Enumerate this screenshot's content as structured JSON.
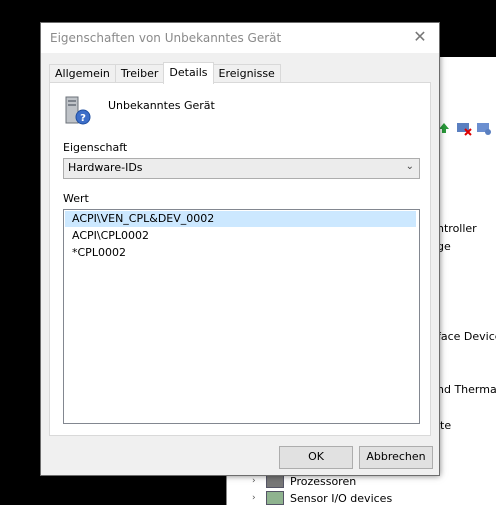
{
  "background": {
    "partial_texts": [
      "ntroller",
      "ge",
      "face Device",
      "nd Thermal",
      "ite"
    ],
    "tree_items": [
      {
        "label": "Prozessoren",
        "icon": "processor-icon"
      },
      {
        "label": "Sensor I/O devices",
        "icon": "sensor-icon"
      }
    ],
    "toolbar_icons": [
      "update-driver-icon",
      "disable-device-icon",
      "uninstall-device-icon",
      "scan-hardware-icon"
    ]
  },
  "dialog": {
    "title": "Eigenschaften von Unbekanntes Gerät",
    "close_symbol": "✕",
    "tabs": [
      {
        "label": "Allgemein",
        "active": false
      },
      {
        "label": "Treiber",
        "active": false
      },
      {
        "label": "Details",
        "active": true
      },
      {
        "label": "Ereignisse",
        "active": false
      }
    ],
    "device_name": "Unbekanntes Gerät",
    "property_label": "Eigenschaft",
    "property_selected": "Hardware-IDs",
    "value_label": "Wert",
    "values": [
      "ACPI\\VEN_CPL&DEV_0002",
      "ACPI\\CPL0002",
      "*CPL0002"
    ],
    "selected_value_index": 0,
    "ok_label": "OK",
    "cancel_label": "Abbrechen"
  }
}
